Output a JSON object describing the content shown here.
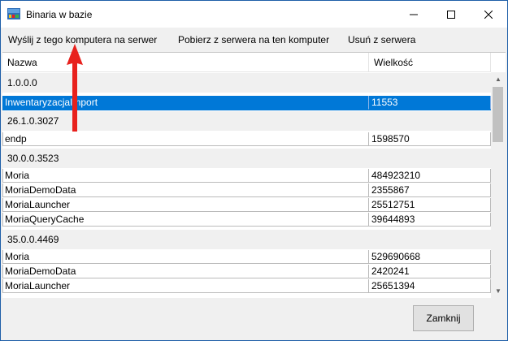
{
  "window": {
    "title": "Binaria w bazie",
    "controls": {
      "minimize": "–",
      "maximize": "☐",
      "close": "✕"
    }
  },
  "menu": {
    "upload": "Wyślij z tego komputera na serwer",
    "download": "Pobierz z serwera na ten komputer",
    "delete": "Usuń z serwera"
  },
  "table": {
    "columns": [
      "Nazwa",
      "Wielkość"
    ],
    "groups": [
      {
        "version": "1.0.0.0",
        "items": [
          {
            "name": "InwentaryzacjaImport",
            "size": "11553",
            "selected": true
          }
        ]
      },
      {
        "version": "26.1.0.3027",
        "items": [
          {
            "name": "endp",
            "size": "1598570"
          }
        ]
      },
      {
        "version": "30.0.0.3523",
        "items": [
          {
            "name": "Moria",
            "size": "484923210"
          },
          {
            "name": "MoriaDemoData",
            "size": "2355867"
          },
          {
            "name": "MoriaLauncher",
            "size": "25512751"
          },
          {
            "name": "MoriaQueryCache",
            "size": "39644893"
          }
        ]
      },
      {
        "version": "35.0.0.4469",
        "items": [
          {
            "name": "Moria",
            "size": "529690668"
          },
          {
            "name": "MoriaDemoData",
            "size": "2420241"
          },
          {
            "name": "MoriaLauncher",
            "size": "25651394"
          }
        ]
      }
    ]
  },
  "footer": {
    "close_label": "Zamknij"
  },
  "colors": {
    "selection": "#0078d7",
    "annotation_arrow": "#e8211d"
  }
}
